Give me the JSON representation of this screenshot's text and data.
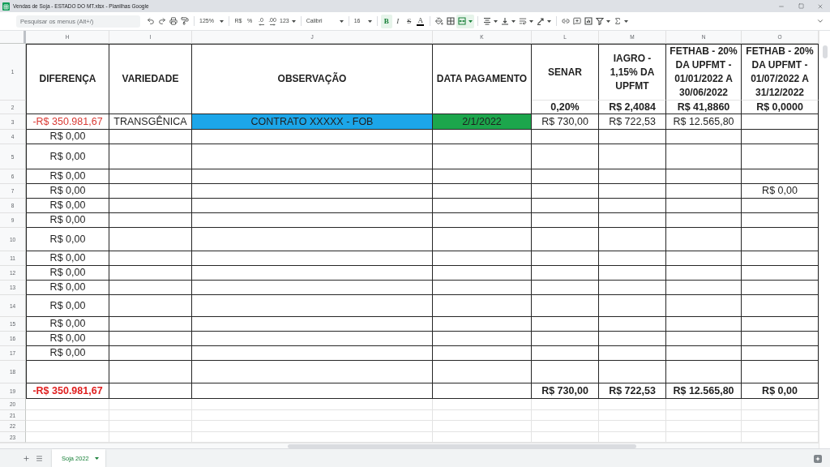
{
  "window": {
    "title": "Vendas de Soja - ESTADO DO MT.xlsx - Planilhas Google"
  },
  "toolbar": {
    "search": {
      "placeholder": "Pesquisar os menus (Alt+/)"
    },
    "groups": [
      {
        "items": [
          {
            "kind": "undo",
            "dropdown": false,
            "on": false
          },
          {
            "kind": "redo",
            "dropdown": false,
            "on": false
          },
          {
            "kind": "print",
            "dropdown": false,
            "on": false
          },
          {
            "kind": "paint_format",
            "dropdown": false,
            "on": false
          }
        ]
      },
      {
        "items": [
          {
            "kind": "zoom",
            "label": "125%",
            "dropdown": true,
            "on": false
          }
        ]
      },
      {
        "items": [
          {
            "kind": "currency",
            "label": "R$",
            "dropdown": false,
            "on": false
          },
          {
            "kind": "percent",
            "label": "%",
            "dropdown": false,
            "on": false
          },
          {
            "kind": "decrease_decimals",
            "label": ".0",
            "dropdown": false,
            "on": false
          },
          {
            "kind": "increase_decimals",
            "label": ".00",
            "dropdown": false,
            "on": false
          },
          {
            "kind": "number_format",
            "label": "123",
            "dropdown": true,
            "on": false
          }
        ]
      },
      {
        "items": [
          {
            "kind": "font",
            "label": "Calibri",
            "dropdown": true,
            "on": false
          }
        ]
      },
      {
        "items": [
          {
            "kind": "font_size",
            "label": "16",
            "dropdown": true,
            "on": false
          }
        ]
      },
      {
        "items": [
          {
            "kind": "bold",
            "label": "B",
            "dropdown": false,
            "on": true
          },
          {
            "kind": "italic",
            "label": "I",
            "dropdown": false,
            "on": false
          },
          {
            "kind": "strikethrough",
            "label": "S",
            "dropdown": false,
            "on": false
          },
          {
            "kind": "text_color",
            "label": "A",
            "dropdown": false,
            "on": false
          }
        ]
      },
      {
        "items": [
          {
            "kind": "fill_color",
            "dropdown": false,
            "on": false
          },
          {
            "kind": "borders",
            "dropdown": false,
            "on": false
          },
          {
            "kind": "merge",
            "dropdown": true,
            "on": true
          }
        ]
      },
      {
        "items": [
          {
            "kind": "align",
            "dropdown": true,
            "on": false
          },
          {
            "kind": "valign",
            "dropdown": true,
            "on": false
          },
          {
            "kind": "wrap",
            "dropdown": true,
            "on": false
          },
          {
            "kind": "rotate",
            "dropdown": true,
            "on": false
          }
        ]
      },
      {
        "items": [
          {
            "kind": "link",
            "dropdown": false,
            "on": false
          },
          {
            "kind": "comment",
            "dropdown": false,
            "on": false
          },
          {
            "kind": "chart",
            "dropdown": false,
            "on": false
          },
          {
            "kind": "filter",
            "dropdown": true,
            "on": false
          },
          {
            "kind": "functions",
            "dropdown": true,
            "on": false
          }
        ]
      }
    ]
  },
  "sheet": {
    "columns": [
      "H",
      "I",
      "J",
      "K",
      "L",
      "M",
      "N",
      "O"
    ],
    "header_rows": [
      "1",
      "2"
    ],
    "header": [
      {
        "title": "DIFERENÇA"
      },
      {
        "title": "VARIEDADE"
      },
      {
        "title": "OBSERVAÇÃO"
      },
      {
        "title": "DATA PAGAMENTO"
      },
      {
        "title": "SENAR",
        "rate": "0,20%"
      },
      {
        "title": "IAGRO - 1,15% DA UPFMT",
        "rate": "R$ 2,4084"
      },
      {
        "title": "FETHAB - 20% DA UPFMT - 01/01/2022 A 30/06/2022",
        "rate": "R$ 41,8860"
      },
      {
        "title": "FETHAB - 20% DA UPFMT - 01/07/2022 A 31/12/2022",
        "rate": "R$ 0,0000"
      }
    ],
    "rows": [
      {
        "number": "3",
        "kind": "data",
        "cells": [
          {
            "text": "-R$ 350.981,67",
            "font": {
              "color": "#d93a34"
            }
          },
          {
            "text": "TRANSGÊNICA"
          },
          {
            "text": "CONTRATO XXXXX - FOB",
            "background": {
              "color": "#1ca6e9"
            }
          },
          {
            "text": "2/1/2022",
            "background": {
              "color": "#1ca64c"
            }
          },
          {
            "text": "R$ 730,00"
          },
          {
            "text": "R$ 722,53"
          },
          {
            "text": "R$ 12.565,80"
          }
        ]
      },
      {
        "number": "4",
        "kind": "data",
        "cells": [
          {
            "text": "R$ 0,00"
          }
        ]
      },
      {
        "number": "5",
        "kind": "data",
        "cells": [
          {
            "text": "R$ 0,00"
          }
        ]
      },
      {
        "number": "6",
        "kind": "data",
        "cells": [
          {
            "text": "R$ 0,00"
          }
        ]
      },
      {
        "number": "7",
        "kind": "data",
        "cells": [
          {
            "text": "R$ 0,00"
          },
          null,
          null,
          null,
          null,
          null,
          null,
          {
            "text": "R$ 0,00"
          }
        ]
      },
      {
        "number": "8",
        "kind": "data",
        "cells": [
          {
            "text": "R$ 0,00"
          }
        ]
      },
      {
        "number": "9",
        "kind": "data",
        "cells": [
          {
            "text": "R$ 0,00"
          }
        ]
      },
      {
        "number": "10",
        "kind": "data",
        "cells": [
          {
            "text": "R$ 0,00"
          }
        ]
      },
      {
        "number": "11",
        "kind": "data",
        "cells": [
          {
            "text": "R$ 0,00"
          }
        ]
      },
      {
        "number": "12",
        "kind": "data",
        "cells": [
          {
            "text": "R$ 0,00"
          }
        ]
      },
      {
        "number": "13",
        "kind": "data",
        "cells": [
          {
            "text": "R$ 0,00"
          }
        ]
      },
      {
        "number": "14",
        "kind": "data",
        "cells": [
          {
            "text": "R$ 0,00"
          }
        ]
      },
      {
        "number": "15",
        "kind": "data",
        "cells": [
          {
            "text": "R$ 0,00"
          }
        ]
      },
      {
        "number": "16",
        "kind": "data",
        "cells": [
          {
            "text": "R$ 0,00"
          }
        ]
      },
      {
        "number": "17",
        "kind": "data",
        "cells": [
          {
            "text": "R$ 0,00"
          }
        ]
      },
      {
        "number": "18",
        "kind": "data"
      },
      {
        "number": "19",
        "kind": "total",
        "cells": [
          {
            "text": "-R$ 350.981,67",
            "font": {
              "color": "#e02020"
            }
          },
          null,
          null,
          null,
          {
            "text": "R$ 730,00"
          },
          {
            "text": "R$ 722,53"
          },
          {
            "text": "R$ 12.565,80"
          },
          {
            "text": "R$ 0,00"
          }
        ]
      },
      {
        "number": "20",
        "kind": "blank"
      },
      {
        "number": "21",
        "kind": "blank"
      },
      {
        "number": "22",
        "kind": "blank"
      },
      {
        "number": "23",
        "kind": "blank"
      }
    ]
  },
  "sheet_tabs": [
    {
      "label": "Soja 2022",
      "selected": true
    }
  ]
}
